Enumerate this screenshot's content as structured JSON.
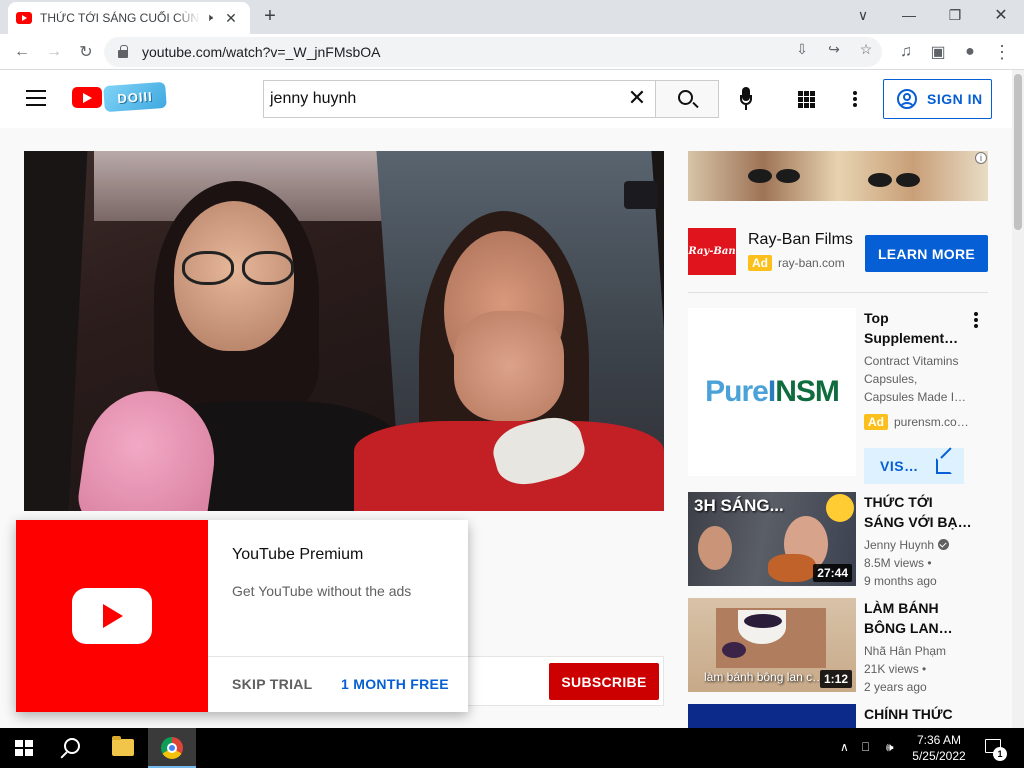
{
  "browser": {
    "tab_title": "THỨC TỚI SÁNG CUỐI CÙNG",
    "audio_icon": "speaker-icon",
    "new_tab_label": "+",
    "url": "youtube.com/watch?v=_W_jnFMsbOA"
  },
  "masthead": {
    "doodle_text": "DOIII",
    "search_value": "jenny huynh",
    "signin_label": "SIGN IN"
  },
  "premium_popup": {
    "title": "YouTube Premium",
    "subtitle": "Get YouTube without the ads",
    "skip_label": "SKIP TRIAL",
    "free_label": "1 MONTH FREE"
  },
  "channel": {
    "subscribe_label": "SUBSCRIBE"
  },
  "ad_rayban": {
    "logo_text": "Ray-Ban",
    "title": "Ray-Ban Films",
    "badge": "Ad",
    "domain": "ray-ban.com",
    "cta": "LEARN MORE",
    "info": "i"
  },
  "ad_purensm": {
    "logo_a": "Pure",
    "logo_b": "I",
    "logo_c": "NSM",
    "title": "Top Supplement…",
    "description": "Contract Vitamins\nCapsules,\nCapsules Made I…",
    "badge": "Ad",
    "domain": "purensm.co…",
    "cta": "VIS…"
  },
  "related": [
    {
      "title": "THỨC TỚI SÁNG VỚI BẠ…",
      "channel": "Jenny Huynh",
      "views": "8.5M views •",
      "age": "9 months ago",
      "duration": "27:44",
      "thumb_text": "3H SÁNG..."
    },
    {
      "title": "LÀM BÁNH BÔNG LAN…",
      "channel": "Nhã Hân Phạm",
      "views": "21K views •",
      "age": "2 years ago",
      "duration": "1:12",
      "thumb_text": "làm bánh bông lan c…"
    },
    {
      "title": "CHÍNH THỨC"
    }
  ],
  "taskbar": {
    "time": "7:36 AM",
    "date": "5/25/2022",
    "notif_count": "1"
  },
  "colors": {
    "brand_red": "#ff0000",
    "subscribe_red": "#cc0000",
    "link_blue": "#065fd4",
    "ad_yellow": "#fcc01d"
  }
}
